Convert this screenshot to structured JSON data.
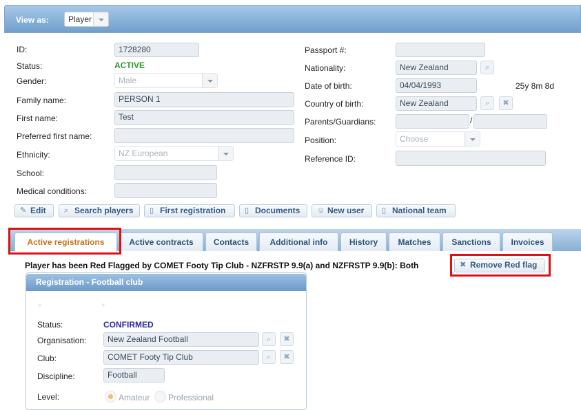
{
  "topbar": {
    "view_as_label": "View as:",
    "view_as_value": "Player"
  },
  "left": {
    "id_label": "ID:",
    "id_value": "1728280",
    "status_label": "Status:",
    "status_value": "ACTIVE",
    "gender_label": "Gender:",
    "gender_value": "Male",
    "family_label": "Family name:",
    "family_value": "PERSON 1",
    "first_label": "First name:",
    "first_value": "Test",
    "preferred_label": "Preferred first name:",
    "preferred_value": "",
    "ethnicity_label": "Ethnicity:",
    "ethnicity_value": "NZ European",
    "school_label": "School:",
    "school_value": "",
    "medical_label": "Medical conditions:",
    "medical_value": ""
  },
  "right": {
    "passport_label": "Passport #:",
    "passport_value": "",
    "nationality_label": "Nationality:",
    "nationality_value": "New Zealand",
    "dob_label": "Date of birth:",
    "dob_value": "04/04/1993",
    "age": "25y 8m 8d",
    "cob_label": "Country of birth:",
    "cob_value": "New Zealand",
    "parents_label": "Parents/Guardians:",
    "parents_sep": "/",
    "position_label": "Position:",
    "position_placeholder": "Choose",
    "reference_label": "Reference ID:",
    "reference_value": ""
  },
  "actions": {
    "edit": "Edit",
    "search": "Search players",
    "first_reg": "First registration",
    "documents": "Documents",
    "new_user": "New user",
    "national_team": "National team"
  },
  "tabs": [
    "Active registrations",
    "Active contracts",
    "Contacts",
    "Additional info",
    "History",
    "Matches",
    "Sanctions",
    "Invoices"
  ],
  "banner": {
    "text": "Player has been Red Flagged by COMET Footy Tip Club - NZFRSTP 9.9(a) and NZFRSTP 9.9(b): Both",
    "remove_button": "Remove Red flag"
  },
  "registration": {
    "title": "Registration - Football club",
    "status_label": "Status:",
    "status_value": "CONFIRMED",
    "org_label": "Organisation:",
    "org_value": "New Zealand Football",
    "club_label": "Club:",
    "club_value": "COMET Footy Tip Club",
    "discipline_label": "Discipline:",
    "discipline_value": "Football",
    "level_label": "Level:",
    "level_amateur": "Amateur",
    "level_professional": "Professional"
  },
  "colors": {
    "active_status": "#2e9a2e",
    "confirmed_status": "#2a2a9a",
    "active_tab": "#c6721c",
    "highlight": "#e01010"
  }
}
